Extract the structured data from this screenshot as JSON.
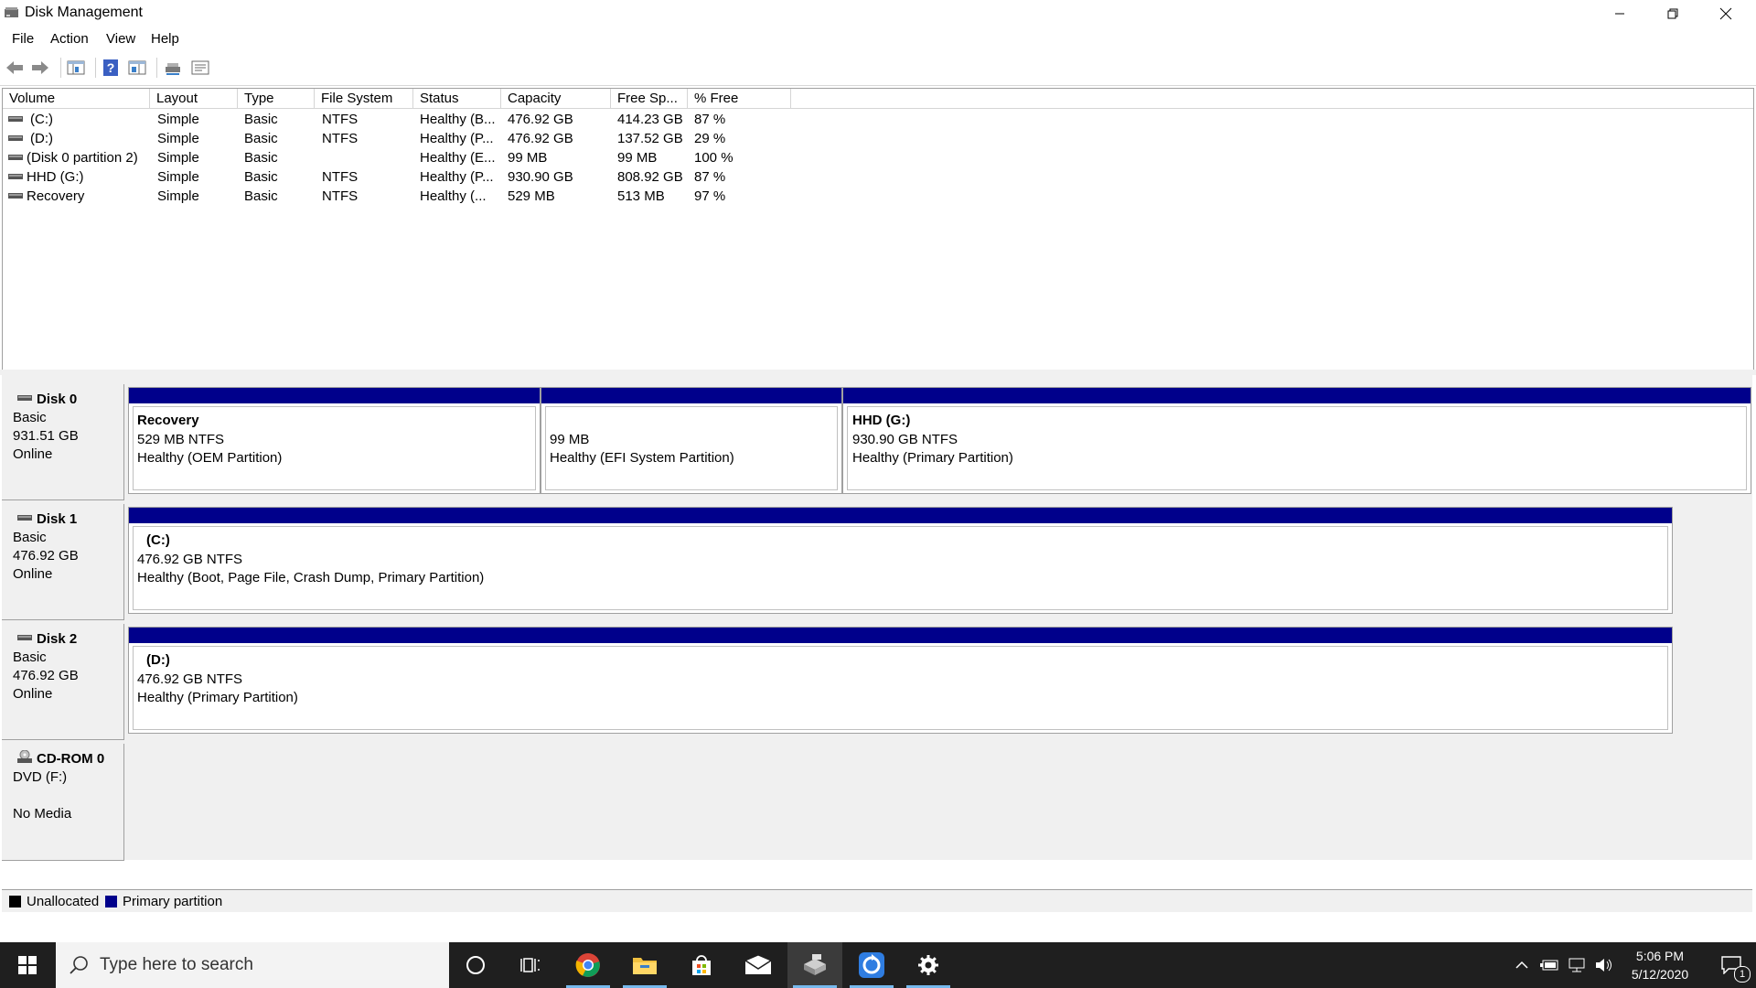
{
  "window": {
    "title": "Disk Management"
  },
  "menu": {
    "items": [
      "File",
      "Action",
      "View",
      "Help"
    ]
  },
  "toolbar": {
    "buttons": [
      "back-icon",
      "forward-icon",
      "console-tree-icon",
      "help-icon",
      "properties-pane-icon",
      "rescan-disks-icon",
      "properties-icon"
    ]
  },
  "volume_list": {
    "columns": [
      "Volume",
      "Layout",
      "Type",
      "File System",
      "Status",
      "Capacity",
      "Free Sp...",
      "% Free"
    ],
    "rows": [
      [
        "(C:)",
        "Simple",
        "Basic",
        "NTFS",
        "Healthy (B...",
        "476.92 GB",
        "414.23 GB",
        "87 %"
      ],
      [
        "(D:)",
        "Simple",
        "Basic",
        "NTFS",
        "Healthy (P...",
        "476.92 GB",
        "137.52 GB",
        "29 %"
      ],
      [
        "(Disk 0 partition 2)",
        "Simple",
        "Basic",
        "",
        "Healthy (E...",
        "99 MB",
        "99 MB",
        "100 %"
      ],
      [
        "HHD (G:)",
        "Simple",
        "Basic",
        "NTFS",
        "Healthy (P...",
        "930.90 GB",
        "808.92 GB",
        "87 %"
      ],
      [
        "Recovery",
        "Simple",
        "Basic",
        "NTFS",
        "Healthy (...",
        "529 MB",
        "513 MB",
        "97 %"
      ]
    ]
  },
  "disks": [
    {
      "name": "Disk 0",
      "type": "Basic",
      "size": "931.51 GB",
      "status": "Online",
      "partitions": [
        {
          "name": "Recovery",
          "size": "529 MB NTFS",
          "status": "Healthy (OEM Partition)"
        },
        {
          "name": "",
          "size": "99 MB",
          "status": "Healthy (EFI System Partition)"
        },
        {
          "name": "HHD  (G:)",
          "size": "930.90 GB NTFS",
          "status": "Healthy (Primary Partition)"
        }
      ]
    },
    {
      "name": "Disk 1",
      "type": "Basic",
      "size": "476.92 GB",
      "status": "Online",
      "partitions": [
        {
          "name": "(C:)",
          "size": "476.92 GB NTFS",
          "status": "Healthy (Boot, Page File, Crash Dump, Primary Partition)"
        }
      ]
    },
    {
      "name": "Disk 2",
      "type": "Basic",
      "size": "476.92 GB",
      "status": "Online",
      "partitions": [
        {
          "name": "(D:)",
          "size": "476.92 GB NTFS",
          "status": "Healthy (Primary Partition)"
        }
      ]
    },
    {
      "name": "CD-ROM 0",
      "type": "DVD (F:)",
      "size": "",
      "status": "No Media",
      "partitions": []
    }
  ],
  "legend": {
    "items": [
      {
        "label": "Unallocated",
        "color": "#000000"
      },
      {
        "label": "Primary partition",
        "color": "#00008b"
      }
    ]
  },
  "taskbar": {
    "search_placeholder": "Type here to search",
    "time": "5:06 PM",
    "date": "5/12/2020",
    "notification_count": "1"
  },
  "colors": {
    "primary_partition": "#00008b",
    "taskbar": "#1f1f1f",
    "active_indicator": "#76b9ed"
  }
}
